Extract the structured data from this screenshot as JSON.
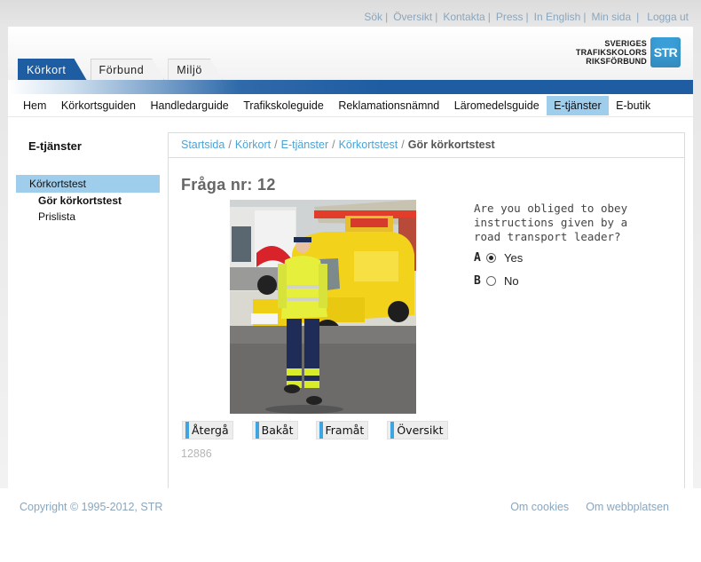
{
  "util_nav": [
    "Sök",
    "Översikt",
    "Kontakta",
    "Press",
    "In English",
    "Min sida",
    "Logga ut"
  ],
  "logo": {
    "line1": "SVERIGES",
    "line2": "TRAFIKSKOLORS",
    "line3": "RIKSFÖRBUND",
    "badge": "STR"
  },
  "tabs": [
    {
      "label": "Körkort",
      "active": true
    },
    {
      "label": "Förbund",
      "active": false
    },
    {
      "label": "Miljö",
      "active": false
    }
  ],
  "main_nav": [
    "Hem",
    "Körkortsguiden",
    "Handledarguide",
    "Trafikskoleguide",
    "Reklamationsnämnd",
    "Läromedelsguide",
    "E-tjänster",
    "E-butik"
  ],
  "main_nav_active": "E-tjänster",
  "sidebar": {
    "title": "E-tjänster",
    "items": [
      {
        "label": "Körkortstest"
      },
      {
        "label": "Gör körkortstest"
      },
      {
        "label": "Prislista"
      }
    ]
  },
  "breadcrumb": [
    "Startsida",
    "Körkort",
    "E-tjänster",
    "Körkortstest"
  ],
  "breadcrumb_current": "Gör körkortstest",
  "question": {
    "title": "Fråga nr: 12",
    "text": "Are you obliged to obey instructions given by a road transport leader?",
    "answers": [
      {
        "letter": "A",
        "label": "Yes",
        "selected": true
      },
      {
        "letter": "B",
        "label": "No",
        "selected": false
      }
    ],
    "id": "12886"
  },
  "buttons": [
    "Återgå",
    "Bakåt",
    "Framåt",
    "Översikt"
  ],
  "footer": {
    "copyright": "Copyright © 1995-2012, STR",
    "links": [
      "Om cookies",
      "Om webbplatsen"
    ]
  },
  "colors": {
    "brand_blue": "#1f5da2",
    "active_highlight": "#9fcdec",
    "link": "#4ba3d6",
    "accent": "#3ea5e0"
  }
}
